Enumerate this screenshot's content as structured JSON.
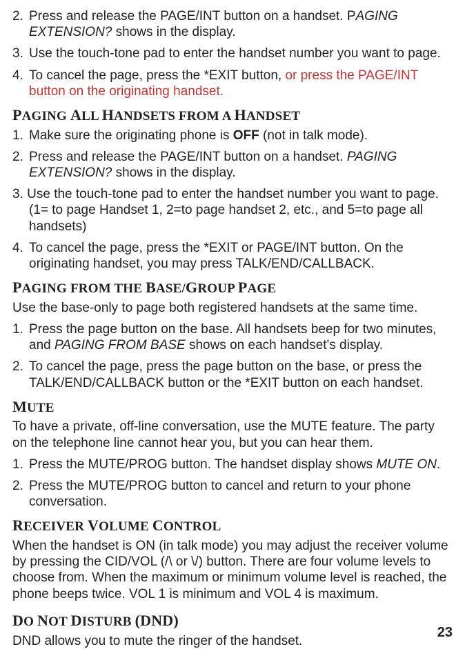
{
  "top_steps": {
    "s2_num": "2.",
    "s2_a": "Press and release the PAGE/INT button on a handset. P",
    "s2_b": "AGING EXTENSION?",
    "s2_c": " shows in the display.",
    "s3_num": "3.",
    "s3": "Use the touch-tone pad to enter the handset number you want to page.",
    "s4_num": "4.",
    "s4_a": "To cancel the page, press the *EXIT button, ",
    "s4_b": "or press the PAGE/INT button on the originating handset."
  },
  "sec_all": {
    "title_parts": {
      "p1": "P",
      "r1": "AGING ",
      "p2": "A",
      "r2": "LL ",
      "p3": "H",
      "r3": "ANDSETS FROM A ",
      "p4": "H",
      "r4": "ANDSET"
    },
    "s1_num": "1.",
    "s1_a": "Make sure the originating phone is ",
    "s1_b": "OFF",
    "s1_c": " (not in talk mode).",
    "s2_num": "2.",
    "s2_a": "Press and release the PAGE/INT button on a handset. ",
    "s2_b": "PAGING EXTENSION?",
    "s2_c": " shows in the display.",
    "s3": "3. Use the touch-tone pad to enter the handset number you want to page. (1= to page Handset 1, 2=to page handset 2, etc., and 5=to page all handsets)",
    "s4_num": "4.",
    "s4": "To cancel the page, press the *EXIT or PAGE/INT button. On the originating handset, you may press TALK/END/CALLBACK."
  },
  "sec_base": {
    "title_parts": {
      "p1": "P",
      "r1": "AGING FROM THE ",
      "p2": "B",
      "r2": "ASE",
      "slash": "/",
      "p3": "G",
      "r3": "ROUP ",
      "p4": "P",
      "r4": "AGE"
    },
    "intro": "Use the base-only to page both registered handsets at the same time.",
    "s1_num": "1.",
    "s1_a": "Press the page button on the base. All handsets beep for two minutes, and ",
    "s1_b": "PAGING FROM BASE",
    "s1_c": " shows on each handset's display.",
    "s2_num": "2.",
    "s2": "To cancel the page, press the page button on the base, or press the TALK/END/CALLBACK button or the *EXIT button on each handset."
  },
  "sec_mute": {
    "title_parts": {
      "p1": "M",
      "r1": "UTE"
    },
    "intro": "To have a private, off-line conversation, use the MUTE feature. The party on the telephone line cannot hear you, but you can hear them.",
    "s1_num": "1.",
    "s1_a": "Press the MUTE/PROG button. The handset display shows ",
    "s1_b": "MUTE ON",
    "s1_c": ".",
    "s2_num": "2.",
    "s2": "Press the MUTE/PROG button to cancel and return to your phone conversation."
  },
  "sec_vol": {
    "title_parts": {
      "p1": "R",
      "r1": "ECEIVER ",
      "p2": "V",
      "r2": "OLUME ",
      "p3": "C",
      "r3": "ONTROL"
    },
    "body": "When the handset is ON (in talk mode) you may adjust the receiver volume by pressing the CID/VOL (/\\ or \\/) button. There are four volume levels to choose from. When the maximum or minimum volume level is reached, the phone beeps twice. VOL 1 is minimum and VOL 4 is maximum."
  },
  "sec_dnd": {
    "title_parts": {
      "p1": "D",
      "r1": "O ",
      "p2": "N",
      "r2": "OT ",
      "p3": "D",
      "r3": "ISTURB ",
      "paren": "(DND)"
    },
    "body": "DND allows you to mute the ringer of the handset."
  },
  "page_number": "23"
}
